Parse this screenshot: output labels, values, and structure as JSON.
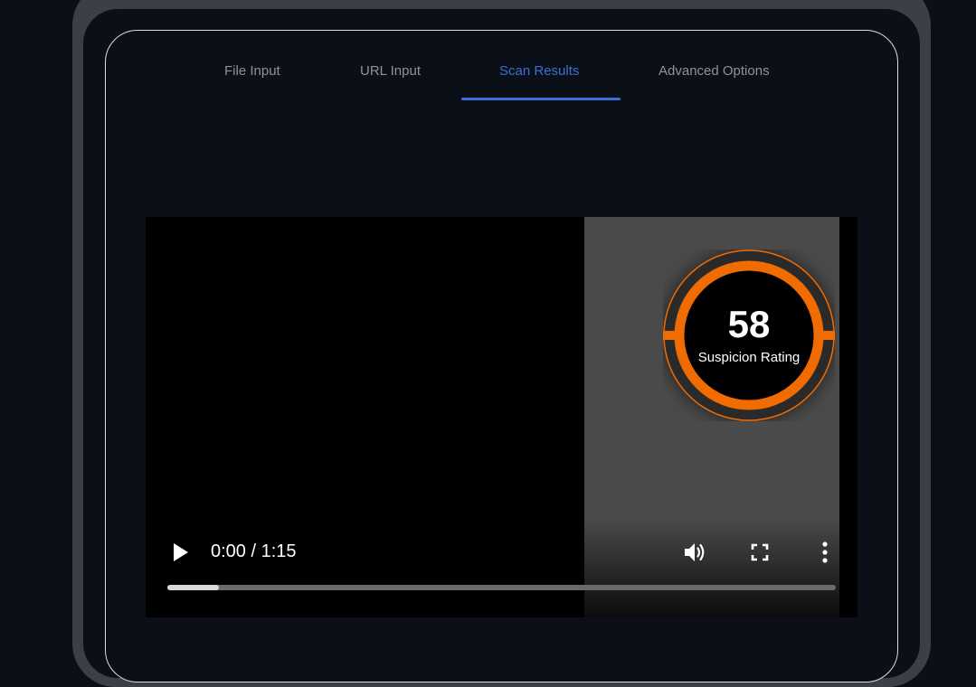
{
  "tabs": [
    {
      "label": "File Input",
      "active": false
    },
    {
      "label": "URL Input",
      "active": false
    },
    {
      "label": "Scan Results",
      "active": true
    },
    {
      "label": "Advanced Options",
      "active": false
    }
  ],
  "video": {
    "time": "0:00 / 1:15",
    "progress": 0.077
  },
  "badge": {
    "score": "58",
    "label": "Suspicion Rating"
  },
  "colors": {
    "accent": "#3b6fd4",
    "badge_ring": "#f06b00"
  },
  "icons": [
    "play-icon",
    "volume-icon",
    "fullscreen-icon",
    "more-options-icon"
  ]
}
